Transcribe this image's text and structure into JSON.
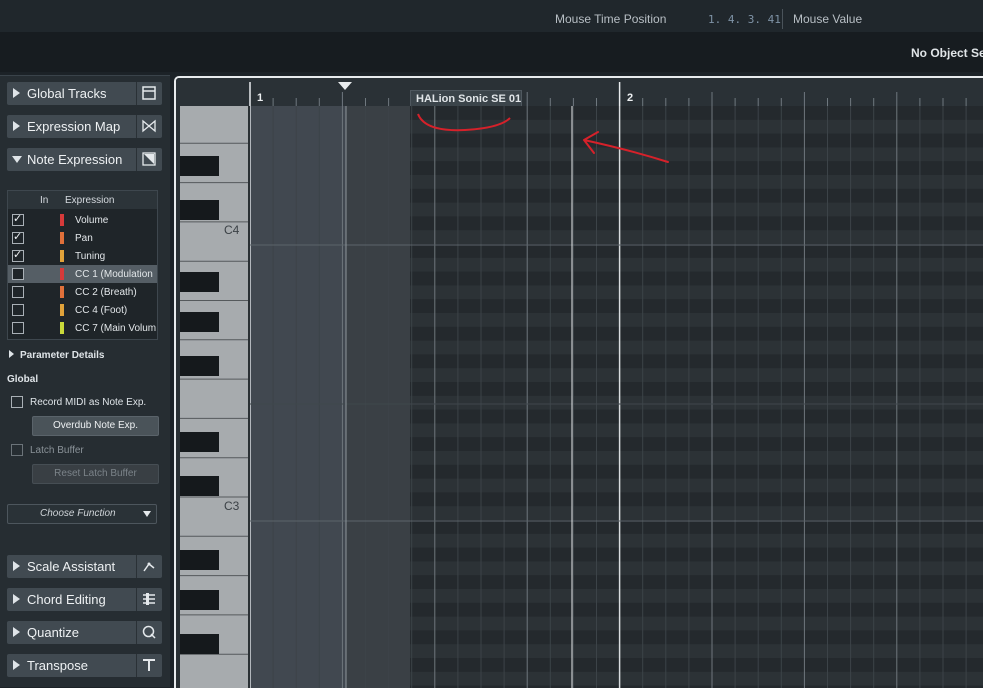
{
  "transport": {
    "mouse_time_label": "Mouse Time Position",
    "mouse_time_value": "1. 4. 3. 41",
    "mouse_value_label": "Mouse Value"
  },
  "info_line": {
    "status": "No Object Sele"
  },
  "inspector": {
    "sections_top": [
      {
        "label": "Global Tracks",
        "icon": "global-tracks-icon"
      },
      {
        "label": "Expression Map",
        "icon": "expression-map-icon"
      },
      {
        "label": "Note Expression",
        "icon": "note-expression-icon",
        "expanded": true
      }
    ],
    "expression_table": {
      "col_in": "In",
      "col_expression": "Expression",
      "rows": [
        {
          "checked": true,
          "color": "#d63a3a",
          "name": "Volume"
        },
        {
          "checked": true,
          "color": "#e0703a",
          "name": "Pan"
        },
        {
          "checked": true,
          "color": "#e0a23a",
          "name": "Tuning"
        },
        {
          "checked": false,
          "color": "#d63a3a",
          "name": "CC 1  (Modulation",
          "selected": true
        },
        {
          "checked": false,
          "color": "#e0703a",
          "name": "CC 2  (Breath)"
        },
        {
          "checked": false,
          "color": "#e0a23a",
          "name": "CC 4  (Foot)"
        },
        {
          "checked": false,
          "color": "#c9d93a",
          "name": "CC 7  (Main Volum"
        }
      ]
    },
    "parameter_details": "Parameter Details",
    "global_label": "Global",
    "record_midi": "Record MIDI as Note Exp.",
    "overdub": "Overdub Note Exp.",
    "latch_buffer": "Latch Buffer",
    "reset_latch": "Reset Latch Buffer",
    "choose_function": "Choose Function",
    "sections_bottom": [
      {
        "label": "Scale Assistant",
        "icon": "scale-assistant-icon"
      },
      {
        "label": "Chord Editing",
        "icon": "chord-editing-icon"
      },
      {
        "label": "Quantize",
        "icon": "quantize-icon"
      },
      {
        "label": "Transpose",
        "icon": "transpose-icon"
      }
    ]
  },
  "editor": {
    "ruler_bar1": "1",
    "ruler_bar2": "2",
    "part_name": "HALion Sonic SE 01",
    "key_c4": "C4",
    "key_c3": "C3"
  },
  "colors": {
    "annotation": "#d6212a",
    "panel": "#262d32",
    "grid": "#2a3034"
  }
}
